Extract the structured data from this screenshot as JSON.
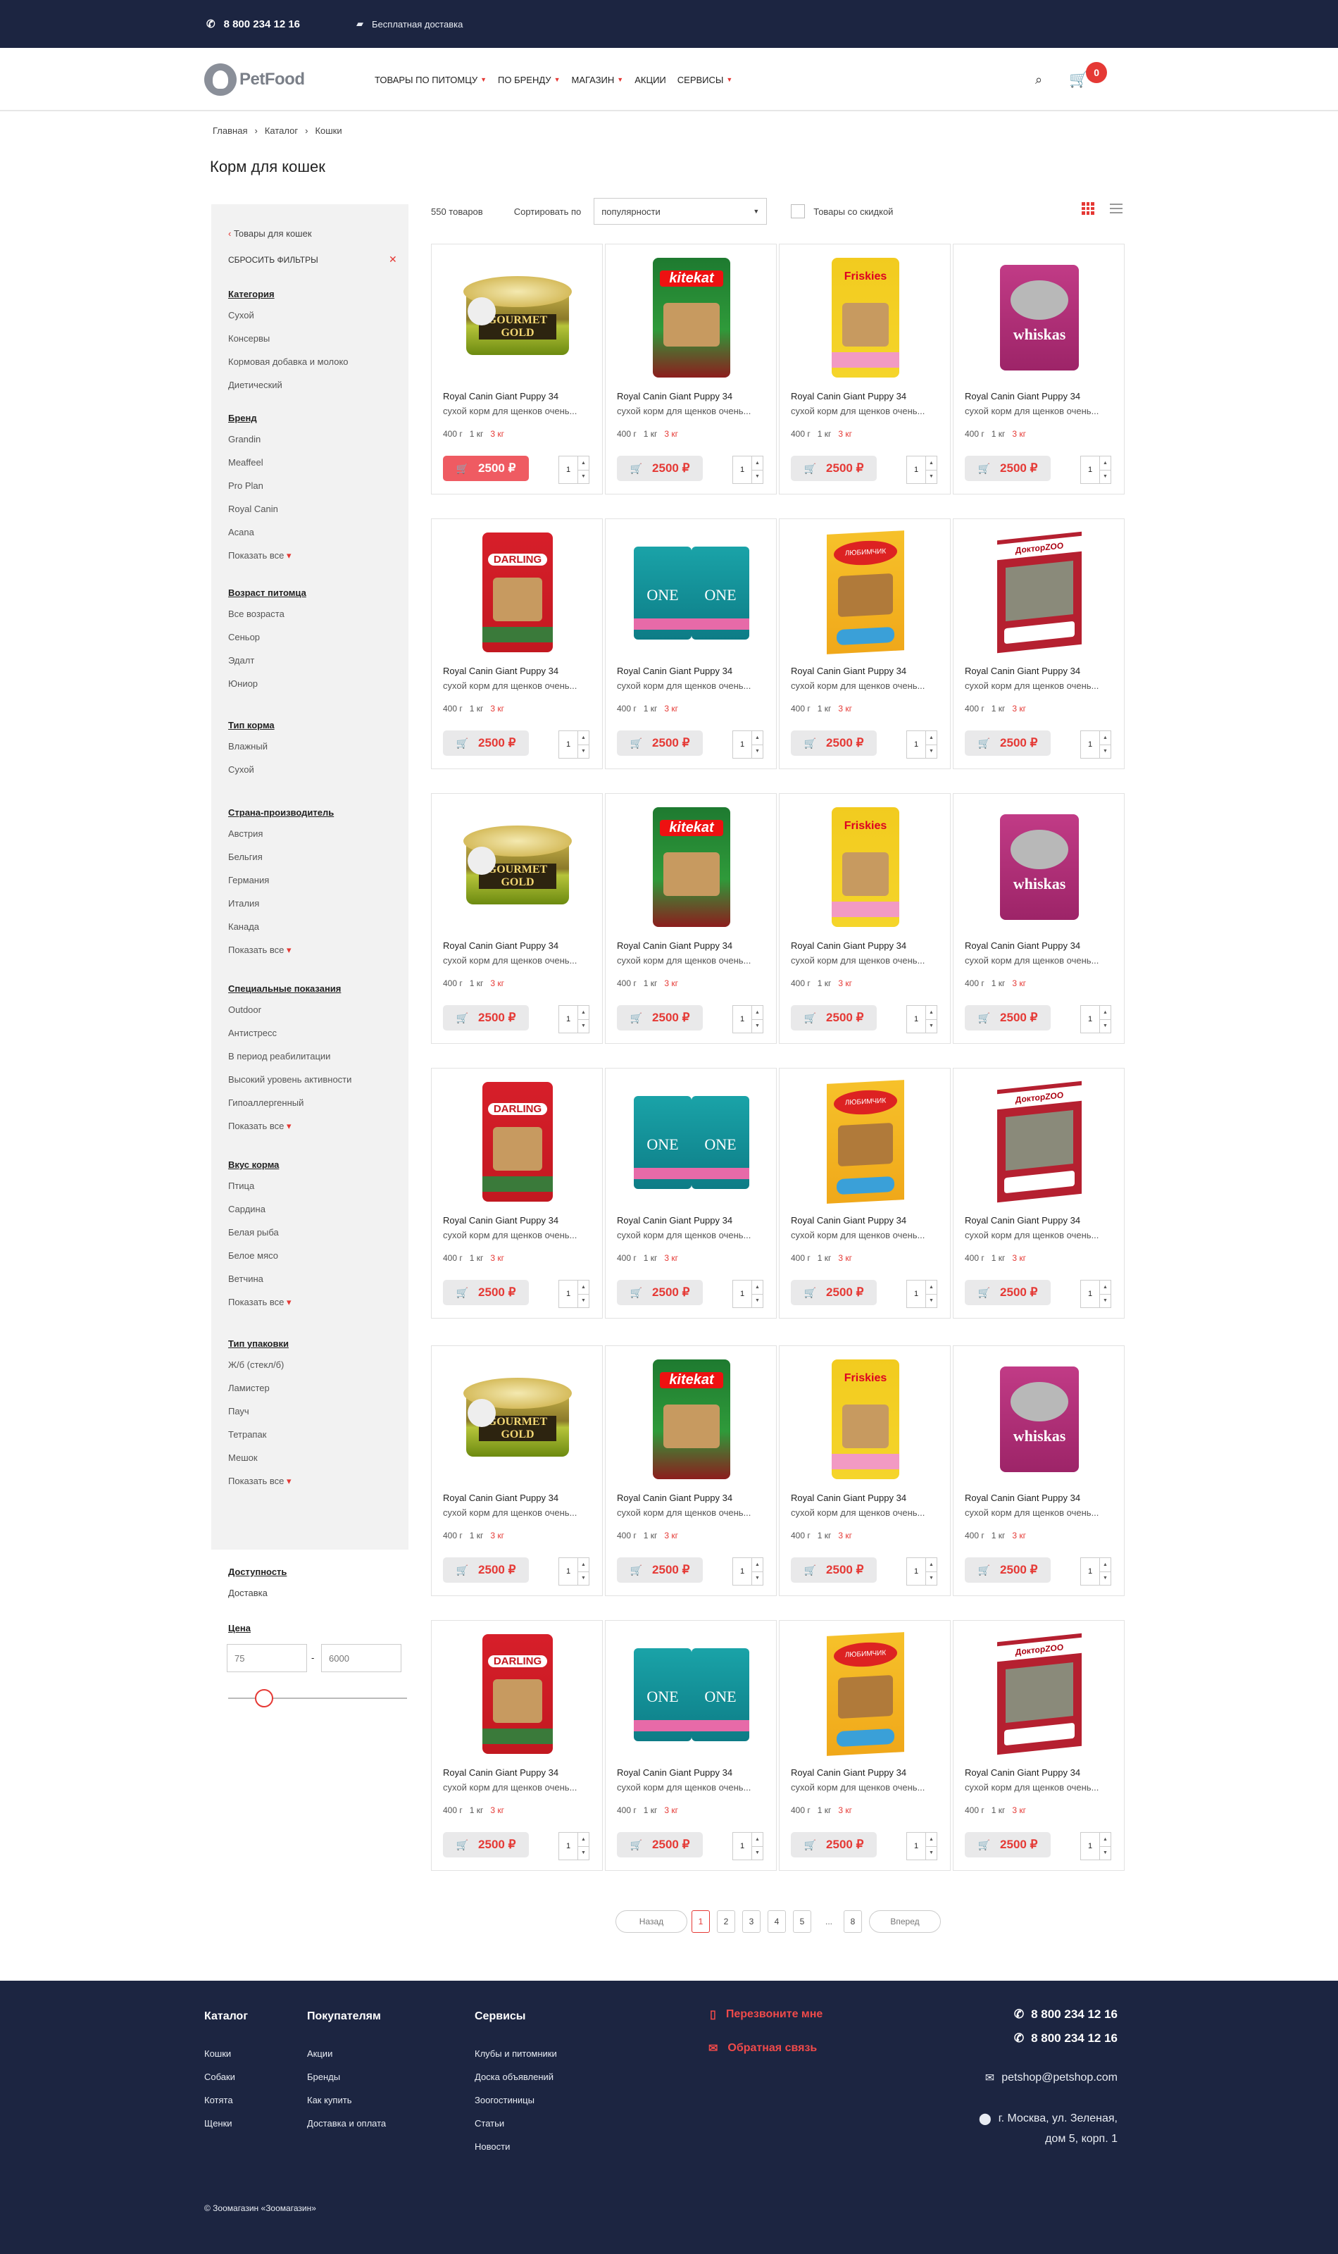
{
  "topbar": {
    "phone": "8 800 234 12 16",
    "delivery": "Бесплатная доставка"
  },
  "header": {
    "logo": "PetFood",
    "nav": [
      "ТОВАРЫ ПО ПИТОМЦУ",
      "ПО БРЕНДУ",
      "МАГАЗИН",
      "АКЦИИ",
      "СЕРВИСЫ"
    ],
    "nav_chevrons": [
      true,
      true,
      true,
      false,
      true
    ],
    "cart_count": "0"
  },
  "breadcrumbs": [
    "Главная",
    "Каталог",
    "Кошки"
  ],
  "page_title": "Корм для кошек",
  "toolbar": {
    "count": "550 товаров",
    "sort_label": "Сортировать по",
    "sort_value": "популярности",
    "discount_label": "Товары со скидкой"
  },
  "sidebar": {
    "back": "Товары для кошек",
    "reset": "СБРОСИТЬ ФИЛЬТРЫ",
    "groups": [
      {
        "title": "Категория",
        "items": [
          "Сухой",
          "Консервы",
          "Кормовая добавка и молоко",
          "Диетический"
        ]
      },
      {
        "title": "Бренд",
        "items": [
          "Grandin",
          "Meaffeel",
          "Pro Plan",
          "Royal Canin",
          "Acana"
        ],
        "more": "Показать все"
      },
      {
        "title": "Возраст питомца",
        "items": [
          "Все возраста",
          "Сеньор",
          "Эдалт",
          "Юниор"
        ]
      },
      {
        "title": "Тип корма",
        "items": [
          "Влажный",
          "Сухой"
        ]
      },
      {
        "title": "Страна-производитель",
        "items": [
          "Австрия",
          "Бельгия",
          "Германия",
          "Италия",
          "Канада"
        ],
        "more": "Показать все"
      },
      {
        "title": "Специальные показания",
        "items": [
          "Outdoor",
          "Антистресс",
          "В период реабилитации",
          "Высокий уровень активности",
          "Гипоаллергенный"
        ],
        "more": "Показать все"
      },
      {
        "title": "Вкус корма",
        "items": [
          "Птица",
          "Сардина",
          "Белая рыба",
          "Белое мясо",
          "Ветчина"
        ],
        "more": "Показать все"
      },
      {
        "title": "Тип упаковки",
        "items": [
          "Ж/б (стекл/б)",
          "Ламистер",
          "Пауч",
          "Тетрапак",
          "Мешок"
        ],
        "more": "Показать все"
      }
    ],
    "availability_title": "Доступность",
    "availability_value": "Доставка",
    "price_title": "Цена",
    "price_min": "75",
    "price_max": "6000",
    "price_dash": "-"
  },
  "product": {
    "name": "Royal Canin Giant Puppy 34",
    "desc": "сухой корм для щенков очень...",
    "weights": [
      "400 г",
      "1 кг",
      "3 кг"
    ],
    "price": "2500 ₽",
    "qty": "1"
  },
  "product_images": [
    "gourmet-can",
    "kitekat-bag",
    "friskies-bag",
    "whiskas-pouch",
    "darling-bag",
    "purina-one-bags",
    "lyubimchik-box",
    "doctorzoo-box"
  ],
  "pagination": {
    "prev": "Назад",
    "pages": [
      "1",
      "2",
      "3",
      "4",
      "5"
    ],
    "dots": "...",
    "last": "8",
    "next": "Вперед",
    "current": "1"
  },
  "footer": {
    "catalog": {
      "title": "Каталог",
      "links": [
        "Кошки",
        "Собаки",
        "Котята",
        "Щенки"
      ]
    },
    "buyers": {
      "title": "Покупателям",
      "links": [
        "Акции",
        "Бренды",
        "Как купить",
        "Доставка и оплата"
      ]
    },
    "services": {
      "title": "Сервисы",
      "links": [
        "Клубы и питомники",
        "Доска объявлений",
        "Зоогостиницы",
        "Статьи",
        "Новости"
      ]
    },
    "callback": "Перезвоните мне",
    "feedback": "Обратная связь",
    "phone1": "8 800 234 12 16",
    "phone2": "8 800 234 12 16",
    "email": "petshop@petshop.com",
    "address1": "г. Москва, ул. Зеленая,",
    "address2": "дом 5, корп. 1",
    "copyright": "© Зоомагазин «Зоомагазин»"
  },
  "colors": {
    "navy": "#1c2541",
    "accent": "#e53935"
  }
}
